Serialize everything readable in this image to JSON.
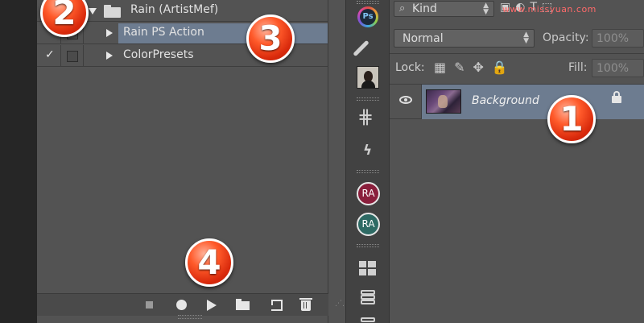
{
  "actions_panel": {
    "rows": [
      {
        "label": "Rain (ArtistMef)",
        "checked": false
      },
      {
        "label": "Rain PS Action",
        "checked": false,
        "selected": true
      },
      {
        "label": "ColorPresets",
        "checked": true,
        "check_glyph": "✓"
      }
    ],
    "bottom_bar": [
      "stop-icon",
      "record-icon",
      "play-icon",
      "folder-icon",
      "new-action-icon",
      "trash-icon"
    ]
  },
  "tool_strip": {
    "ps_badge_text": "Ps",
    "ra_badges": [
      {
        "text": "RA",
        "color": "#8a1f3c"
      },
      {
        "text": "RA",
        "color": "#2e6a64"
      }
    ],
    "icons": [
      "photoshop-badge-icon",
      "brush-icon",
      "portrait-icon",
      "grid-icon",
      "bolt-icon",
      "tiles-icon",
      "layers-icon"
    ]
  },
  "layers_panel": {
    "kind_label": "Kind",
    "watermark": "www.missyuan.com",
    "blend_mode": "Normal",
    "opacity_label": "Opacity:",
    "opacity_value": "100%",
    "lock_label": "Lock:",
    "fill_label": "Fill:",
    "fill_value": "100%",
    "layers": [
      {
        "name": "Background",
        "visible": true,
        "locked": true,
        "selected": true
      }
    ]
  },
  "callouts": [
    "1",
    "2",
    "3",
    "4"
  ],
  "colors": {
    "selection": "#6d7c90",
    "panel_bg": "#535353",
    "callout_red": "#d92a0c"
  }
}
